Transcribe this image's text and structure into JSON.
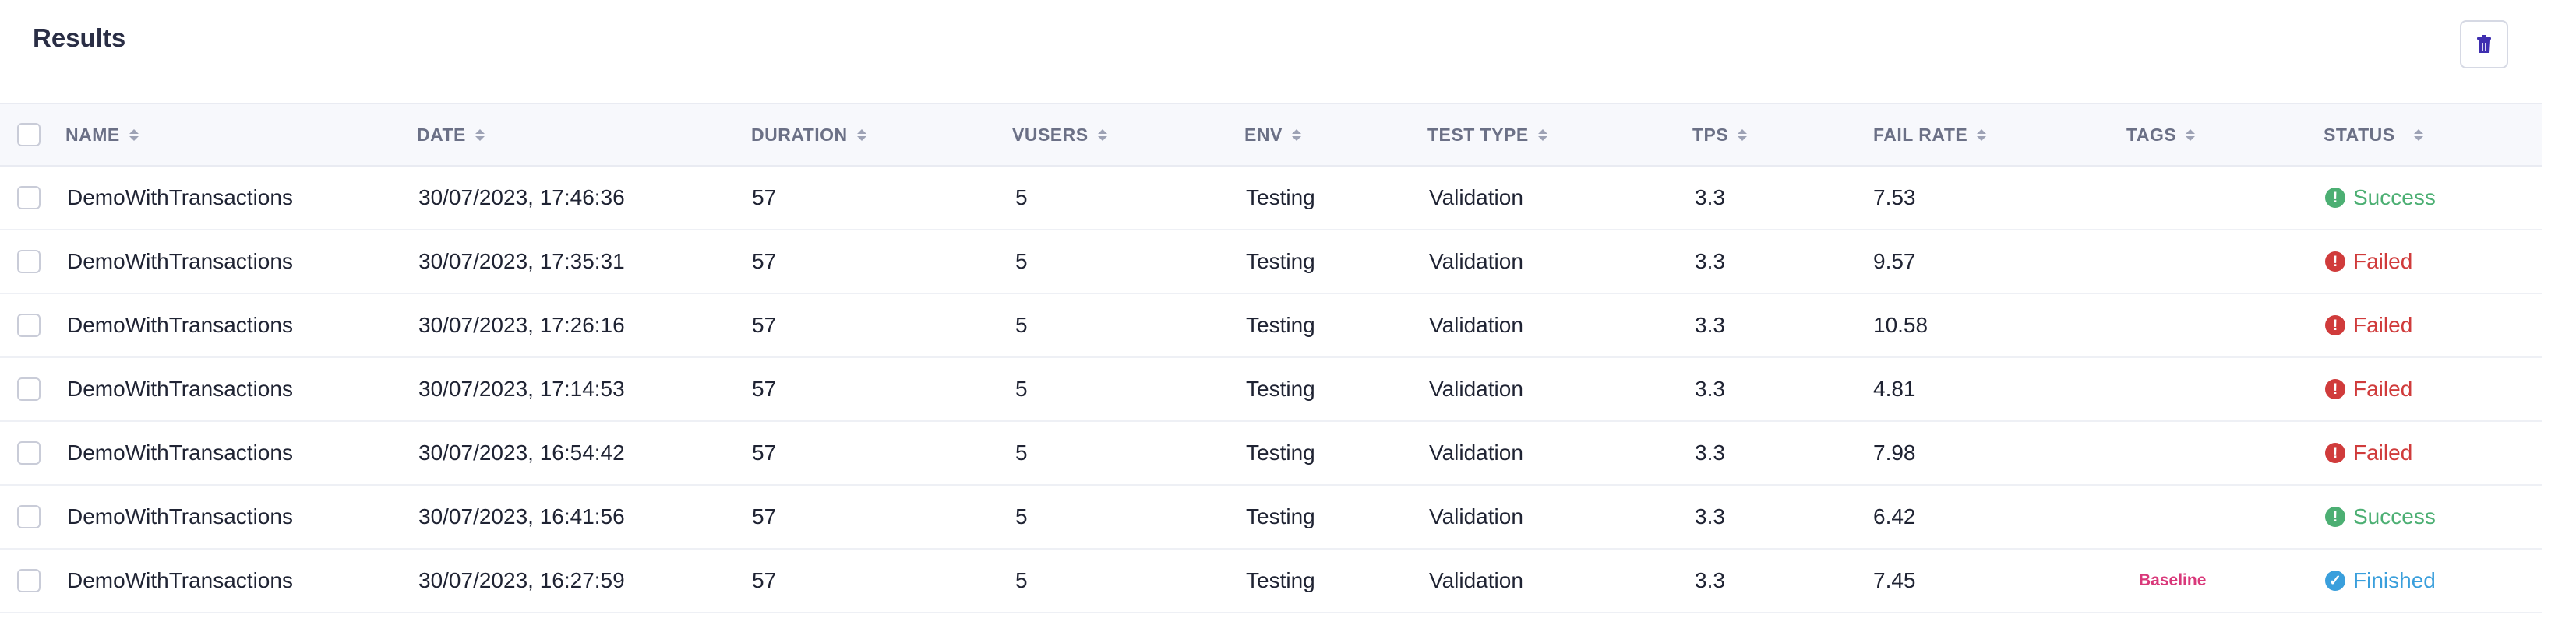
{
  "header": {
    "title": "Results",
    "delete_icon": "trash-icon"
  },
  "columns": [
    "NAME",
    "DATE",
    "DURATION",
    "VUSERS",
    "ENV",
    "TEST TYPE",
    "TPS",
    "FAIL RATE",
    "TAGS",
    "STATUS"
  ],
  "status_colors": {
    "Success": "#4caf73",
    "Failed": "#d03b3b",
    "Finished": "#3a9fdc"
  },
  "tag_color": "#d9387a",
  "rows": [
    {
      "name": "DemoWithTransactions",
      "date": "30/07/2023, 17:46:36",
      "duration": "57",
      "vusers": "5",
      "env": "Testing",
      "test_type": "Validation",
      "tps": "3.3",
      "fail_rate": "7.53",
      "tag": "",
      "status": "Success",
      "status_icon": "success-icon"
    },
    {
      "name": "DemoWithTransactions",
      "date": "30/07/2023, 17:35:31",
      "duration": "57",
      "vusers": "5",
      "env": "Testing",
      "test_type": "Validation",
      "tps": "3.3",
      "fail_rate": "9.57",
      "tag": "",
      "status": "Failed",
      "status_icon": "failed-icon"
    },
    {
      "name": "DemoWithTransactions",
      "date": "30/07/2023, 17:26:16",
      "duration": "57",
      "vusers": "5",
      "env": "Testing",
      "test_type": "Validation",
      "tps": "3.3",
      "fail_rate": "10.58",
      "tag": "",
      "status": "Failed",
      "status_icon": "failed-icon"
    },
    {
      "name": "DemoWithTransactions",
      "date": "30/07/2023, 17:14:53",
      "duration": "57",
      "vusers": "5",
      "env": "Testing",
      "test_type": "Validation",
      "tps": "3.3",
      "fail_rate": "4.81",
      "tag": "",
      "status": "Failed",
      "status_icon": "failed-icon"
    },
    {
      "name": "DemoWithTransactions",
      "date": "30/07/2023, 16:54:42",
      "duration": "57",
      "vusers": "5",
      "env": "Testing",
      "test_type": "Validation",
      "tps": "3.3",
      "fail_rate": "7.98",
      "tag": "",
      "status": "Failed",
      "status_icon": "failed-icon"
    },
    {
      "name": "DemoWithTransactions",
      "date": "30/07/2023, 16:41:56",
      "duration": "57",
      "vusers": "5",
      "env": "Testing",
      "test_type": "Validation",
      "tps": "3.3",
      "fail_rate": "6.42",
      "tag": "",
      "status": "Success",
      "status_icon": "success-icon"
    },
    {
      "name": "DemoWithTransactions",
      "date": "30/07/2023, 16:27:59",
      "duration": "57",
      "vusers": "5",
      "env": "Testing",
      "test_type": "Validation",
      "tps": "3.3",
      "fail_rate": "7.45",
      "tag": "Baseline",
      "status": "Finished",
      "status_icon": "finished-icon"
    }
  ]
}
